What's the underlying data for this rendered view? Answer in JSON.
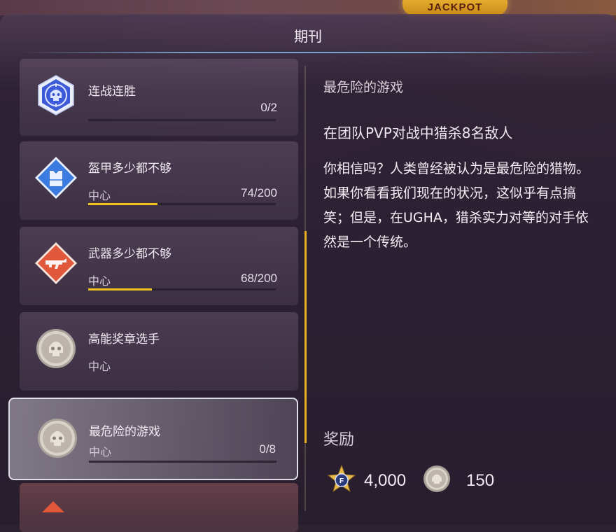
{
  "header": {
    "title": "期刊",
    "jackpot_sign": "JACKPOT"
  },
  "entries": [
    {
      "name": "连战连胜",
      "category": "",
      "progress": "0/2",
      "progress_fraction": 0.0,
      "icon": "skull-shield-icon"
    },
    {
      "name": "盔甲多少都不够",
      "category": "中心",
      "progress": "74/200",
      "progress_fraction": 0.37,
      "icon": "armor-vest-icon"
    },
    {
      "name": "武器多少都不够",
      "category": "中心",
      "progress": "68/200",
      "progress_fraction": 0.34,
      "icon": "rifle-icon"
    },
    {
      "name": "高能奖章选手",
      "category": "中心",
      "progress": "",
      "progress_fraction": null,
      "icon": "medal-coin-icon"
    },
    {
      "name": "最危险的游戏",
      "category": "中心",
      "progress": "0/8",
      "progress_fraction": 0.0,
      "icon": "medal-coin-icon",
      "selected": true
    }
  ],
  "detail": {
    "title": "最危险的游戏",
    "objective": "在团队PVP对战中猎杀8名敌人",
    "description": "你相信吗？人类曾经被认为是最危险的猎物。如果你看看我们现在的状况，这似乎有点搞笑；但是，在UGHA，猎杀实力对等的对手依然是一个传统。",
    "rewards_label": "奖励",
    "rewards": [
      {
        "icon": "star-badge-icon",
        "amount": "4,000"
      },
      {
        "icon": "medal-coin-icon",
        "amount": "150"
      }
    ]
  },
  "colors": {
    "accent_yellow": "#f2c21c",
    "skull_badge_blue": "#3d5bd8",
    "armor_badge_blue": "#3a7be0",
    "weapon_badge_orange": "#e0573a"
  }
}
